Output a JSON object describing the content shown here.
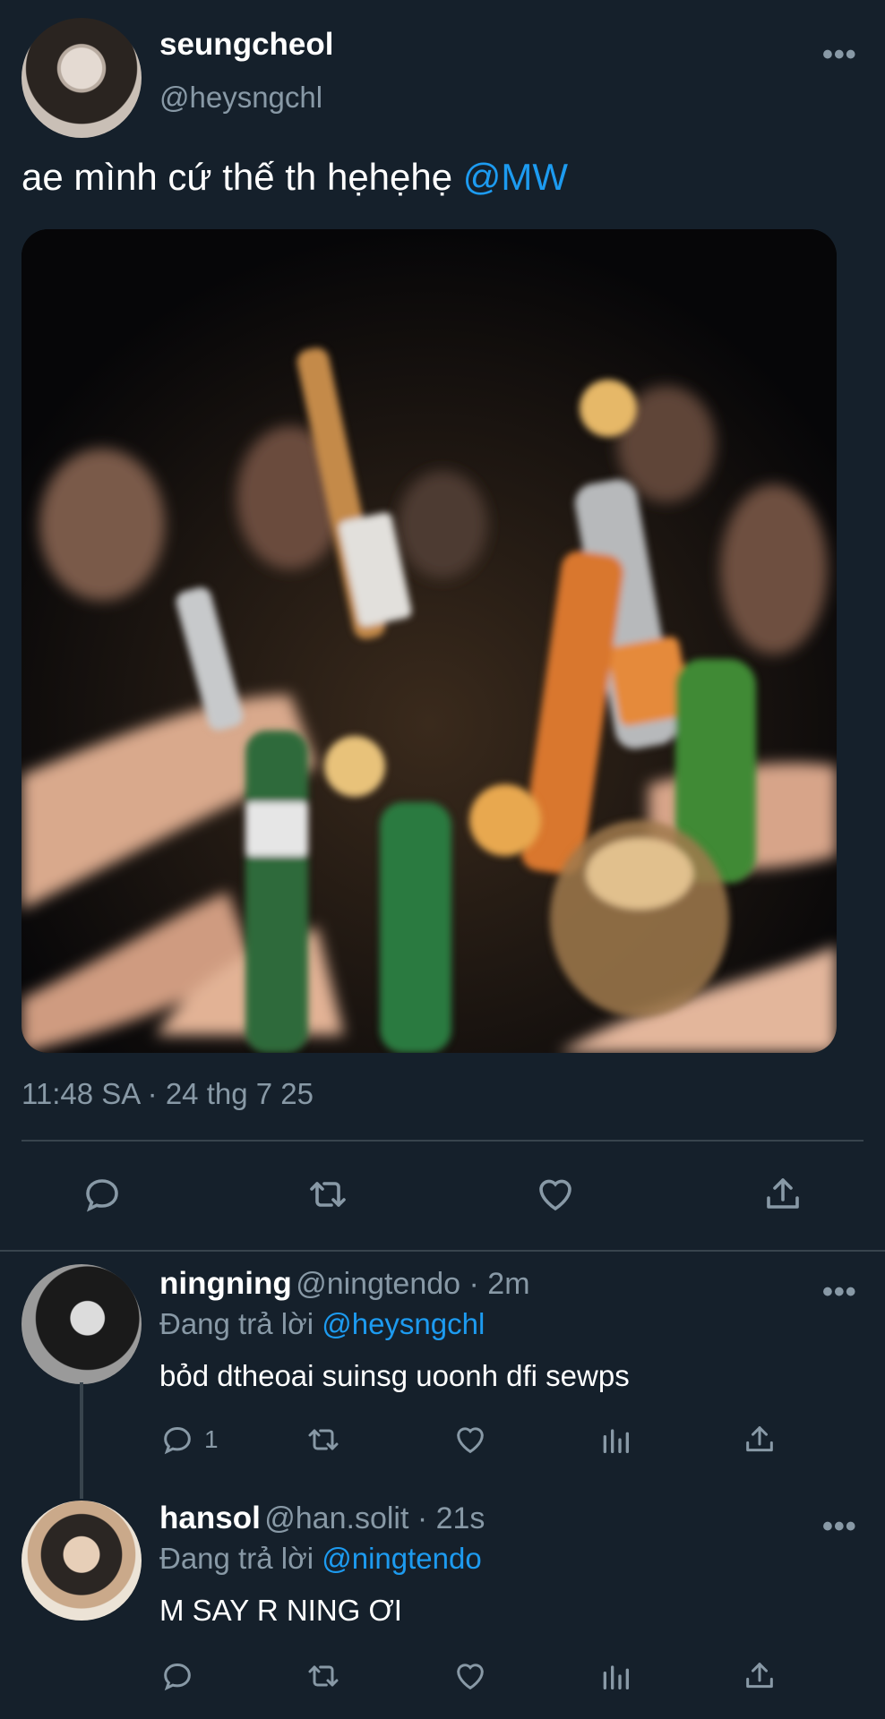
{
  "tweet": {
    "name": "seungcheol",
    "handle": "@heysngchl",
    "text": "ae mình cứ thế th hẹhẹhẹ ",
    "mention": "@MW",
    "timestamp": "11:48 SA · 24 thg 7 25"
  },
  "replies": [
    {
      "name": "ningning",
      "meta": "@ningtendo · 2m",
      "replying_prefix": "Đang trả lời ",
      "replying_to": "@heysngchl",
      "text": "bỏd dtheoai suinsg uoonh dfi sewps",
      "reply_count": "1"
    },
    {
      "name": "hansol",
      "meta": "@han.solit · 21s",
      "replying_prefix": "Đang trả lời ",
      "replying_to": "@ningtendo",
      "text": "M SAY R NING ƠI",
      "reply_count": ""
    }
  ],
  "icons": [
    "more-icon",
    "reply-icon",
    "retweet-icon",
    "like-icon",
    "views-icon",
    "share-icon"
  ],
  "colors": {
    "background": "#15202b",
    "accent": "#1d9bf0",
    "muted": "#8899a6",
    "divider": "#38444d"
  }
}
